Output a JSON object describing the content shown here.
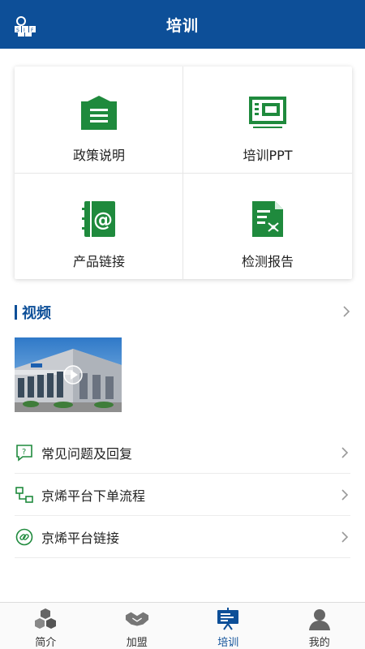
{
  "header": {
    "title": "培训",
    "logo_icon": "company-logo"
  },
  "colors": {
    "brand_blue": "#0d4f98",
    "icon_green": "#1f8a3d"
  },
  "grid": [
    {
      "label": "政策说明",
      "icon": "document-list-icon"
    },
    {
      "label": "培训PPT",
      "icon": "presentation-icon"
    },
    {
      "label": "产品链接",
      "icon": "address-book-icon"
    },
    {
      "label": "检测报告",
      "icon": "report-chart-icon"
    }
  ],
  "video_section": {
    "title": "视频"
  },
  "links": [
    {
      "label": "常见问题及回复",
      "icon": "faq-icon"
    },
    {
      "label": "京烯平台下单流程",
      "icon": "flow-icon"
    },
    {
      "label": "京烯平台链接",
      "icon": "link-icon"
    }
  ],
  "tabs": [
    {
      "label": "简介",
      "icon": "cubes-icon",
      "active": false
    },
    {
      "label": "加盟",
      "icon": "handshake-icon",
      "active": false
    },
    {
      "label": "培训",
      "icon": "training-icon",
      "active": true
    },
    {
      "label": "我的",
      "icon": "user-icon",
      "active": false
    }
  ]
}
